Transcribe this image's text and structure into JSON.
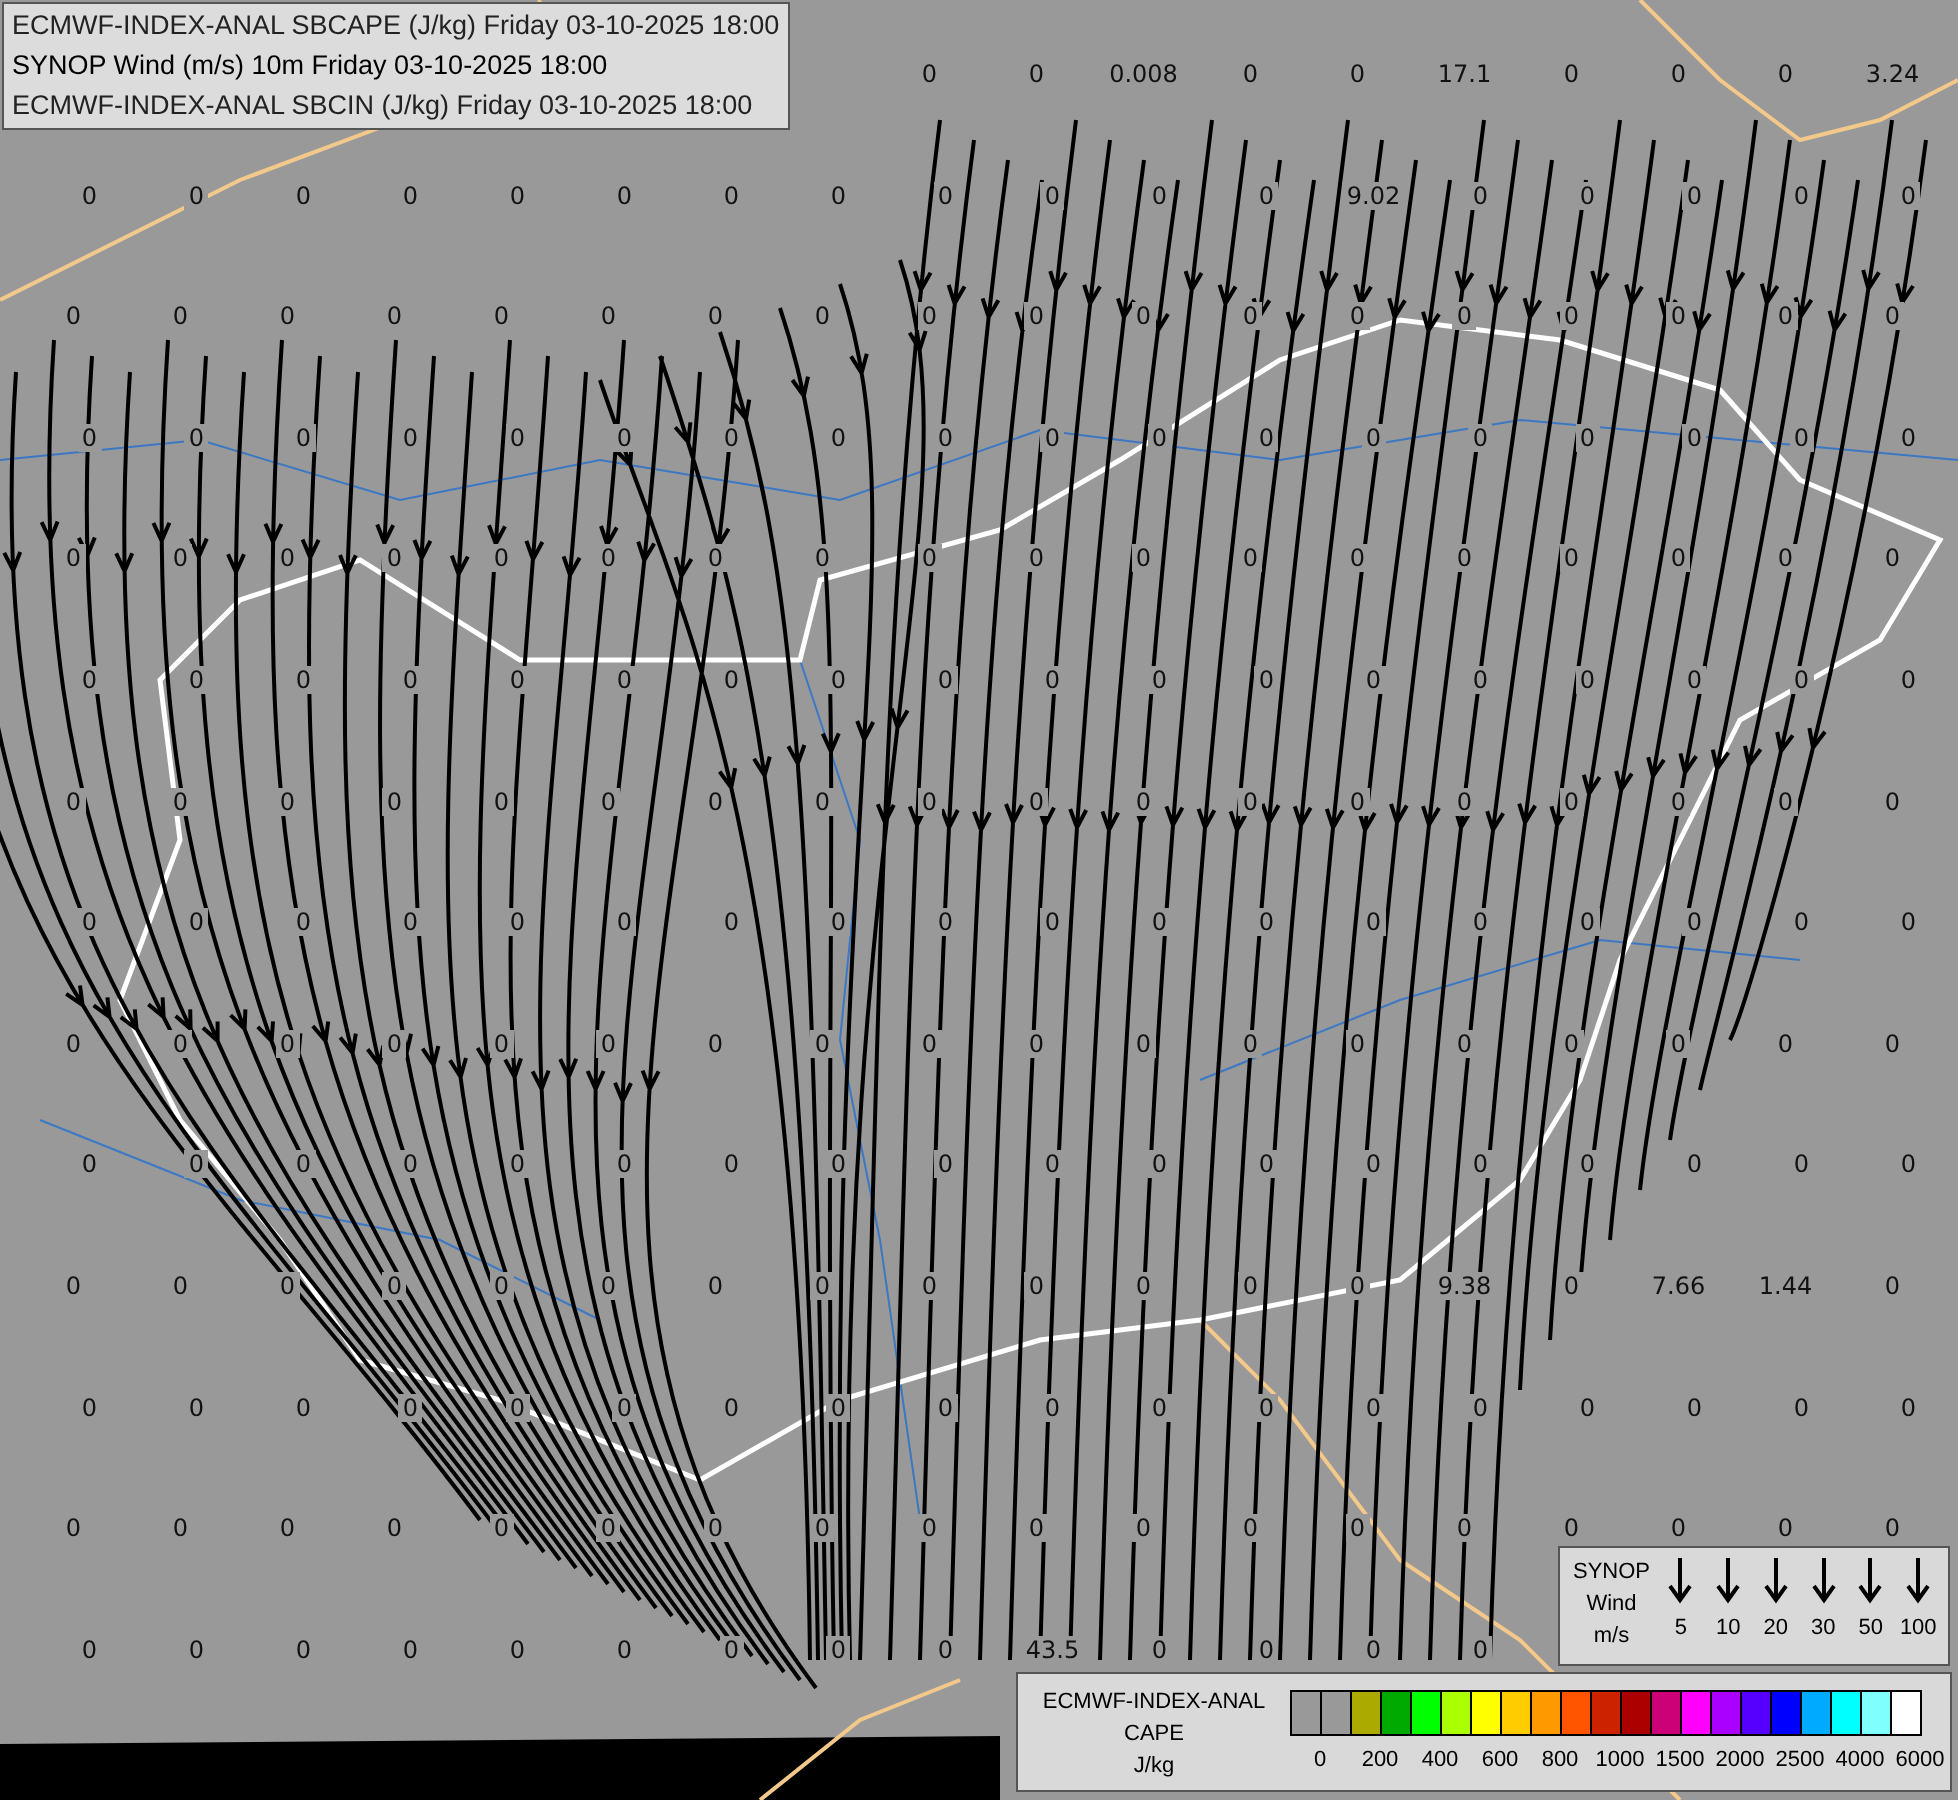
{
  "title_box": {
    "lines": [
      "ECMWF-INDEX-ANAL SBCAPE (J/kg) Friday 03-10-2025 18:00",
      "SYNOP Wind (m/s) 10m Friday 03-10-2025 18:00",
      "ECMWF-INDEX-ANAL SBCIN (J/kg) Friday 03-10-2025 18:00"
    ]
  },
  "grid_values": [
    [
      "0",
      "0",
      "0.008",
      "0",
      "0",
      "17.1",
      "0",
      "0",
      "0",
      "3.24"
    ],
    [
      "0",
      "0",
      "0",
      "0",
      "0",
      "0",
      "0",
      "0",
      "0",
      "0",
      "0",
      "0",
      "9.02",
      "0",
      "0",
      "0",
      "0",
      "0"
    ],
    [
      "0",
      "0",
      "0",
      "0",
      "0",
      "0",
      "0",
      "0",
      "0",
      "0",
      "0",
      "0",
      "0",
      "0",
      "0",
      "0",
      "0",
      "0"
    ],
    [
      "0",
      "0",
      "0",
      "0",
      "0",
      "0",
      "0",
      "0",
      "0",
      "0",
      "0",
      "0",
      "0",
      "0",
      "0",
      "0",
      "0",
      "0"
    ],
    [
      "0",
      "0",
      "0",
      "0",
      "0",
      "0",
      "0",
      "0",
      "0",
      "0",
      "0",
      "0",
      "0",
      "0",
      "0",
      "0",
      "0",
      "0"
    ],
    [
      "0",
      "0",
      "0",
      "0",
      "0",
      "0",
      "0",
      "0",
      "0",
      "0",
      "0",
      "0",
      "0",
      "0",
      "0",
      "0",
      "0",
      "0"
    ],
    [
      "0",
      "0",
      "0",
      "0",
      "0",
      "0",
      "0",
      "0",
      "0",
      "0",
      "0",
      "0",
      "0",
      "0",
      "0",
      "0",
      "0",
      "0"
    ],
    [
      "0",
      "0",
      "0",
      "0",
      "0",
      "0",
      "0",
      "0",
      "0",
      "0",
      "0",
      "0",
      "0",
      "0",
      "0",
      "0",
      "0",
      "0"
    ],
    [
      "0",
      "0",
      "0",
      "0",
      "0",
      "0",
      "0",
      "0",
      "0",
      "0",
      "0",
      "0",
      "0",
      "0",
      "0",
      "0",
      "0",
      "0"
    ],
    [
      "0",
      "0",
      "0",
      "0",
      "0",
      "0",
      "0",
      "0",
      "0",
      "0",
      "0",
      "0",
      "0",
      "0",
      "0",
      "0",
      "0",
      "0"
    ],
    [
      "0",
      "0",
      "0",
      "0",
      "0",
      "0",
      "0",
      "0",
      "0",
      "0",
      "0",
      "0",
      "0",
      "9.38",
      "0",
      "7.66",
      "1.44",
      "0"
    ],
    [
      "0",
      "0",
      "0",
      "0",
      "0",
      "0",
      "0",
      "0",
      "0",
      "0",
      "0",
      "0",
      "0",
      "0",
      "0",
      "0",
      "0",
      "0"
    ],
    [
      "0",
      "0",
      "0",
      "0",
      "0",
      "0",
      "0",
      "0",
      "0",
      "0",
      "0",
      "0",
      "0",
      "0",
      "0",
      "0",
      "0",
      "0"
    ],
    [
      "0",
      "0",
      "0",
      "0",
      "0",
      "0",
      "0",
      "0",
      "0",
      "43.5",
      "0",
      "0",
      "0",
      "0"
    ]
  ],
  "wind_legend": {
    "title_lines": [
      "SYNOP",
      "Wind",
      "m/s"
    ],
    "speeds": [
      "5",
      "10",
      "20",
      "30",
      "50",
      "100"
    ]
  },
  "cape_legend": {
    "title_lines": [
      "ECMWF-INDEX-ANAL",
      "CAPE",
      "J/kg"
    ],
    "swatches": [
      {
        "color": "#999999"
      },
      {
        "color": "#999999"
      },
      {
        "color": "#aaaa00"
      },
      {
        "color": "#00aa00"
      },
      {
        "color": "#00ff00"
      },
      {
        "color": "#aaff00"
      },
      {
        "color": "#ffff00"
      },
      {
        "color": "#ffcc00"
      },
      {
        "color": "#ff9900"
      },
      {
        "color": "#ff5500"
      },
      {
        "color": "#cc2200"
      },
      {
        "color": "#aa0000"
      },
      {
        "color": "#cc0077"
      },
      {
        "color": "#ff00ff"
      },
      {
        "color": "#aa00ff"
      },
      {
        "color": "#5500ff"
      },
      {
        "color": "#0000ff"
      },
      {
        "color": "#00aaff"
      },
      {
        "color": "#00ffff"
      },
      {
        "color": "#80ffff"
      },
      {
        "color": "#ffffff"
      }
    ],
    "ticks": [
      "0",
      "200",
      "400",
      "600",
      "800",
      "1000",
      "1500",
      "2000",
      "2500",
      "4000",
      "6000"
    ]
  }
}
